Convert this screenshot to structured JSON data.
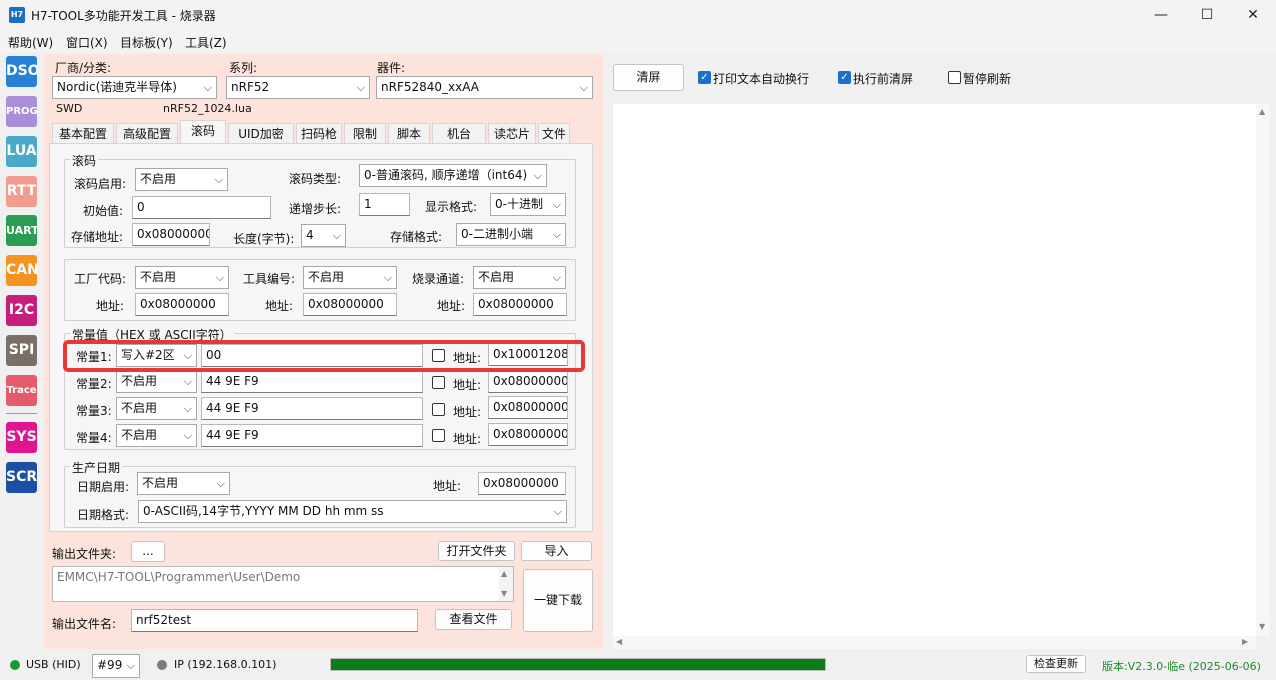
{
  "window": {
    "app_icon": "H7",
    "title": "H7-TOOL多功能开发工具 - 烧录器",
    "minimize": "—",
    "maximize": "☐",
    "close": "✕"
  },
  "menu": [
    "帮助(W)",
    "窗口(X)",
    "目标板(Y)",
    "工具(Z)"
  ],
  "sidebar": [
    {
      "label": "DSO",
      "color": "#2a7fd6"
    },
    {
      "label": "PROG",
      "color": "#a98fd8"
    },
    {
      "label": "LUA",
      "color": "#4aa9c7"
    },
    {
      "label": "RTT",
      "color": "#f29b8f"
    },
    {
      "label": "UART",
      "color": "#2a9d52"
    },
    {
      "label": "CAN",
      "color": "#f59321"
    },
    {
      "label": "I2C",
      "color": "#c51f7e"
    },
    {
      "label": "SPI",
      "color": "#7a6e69"
    },
    {
      "label": "Trace",
      "color": "#e65b6b"
    },
    {
      "label": "SYS",
      "color": "#e0148c"
    },
    {
      "label": "SCR",
      "color": "#1d4fa5"
    }
  ],
  "device": {
    "vendor_label": "厂商/分类:",
    "vendor_value": "Nordic(诺迪克半导体)",
    "series_label": "系列:",
    "series_value": "nRF52",
    "part_label": "器件:",
    "part_value": "nRF52840_xxAA",
    "interface": "SWD",
    "lua_file": "nRF52_1024.lua"
  },
  "tabs": [
    "基本配置",
    "高级配置",
    "滚码",
    "UID加密",
    "扫码枪",
    "限制",
    "脚本",
    "机台",
    "读芯片",
    "文件"
  ],
  "rolling": {
    "group_title": "滚码",
    "enable_label": "滚码启用:",
    "enable_value": "不启用",
    "type_label": "滚码类型:",
    "type_value": "0-普通滚码, 顺序递增（int64)",
    "init_label": "初始值:",
    "init_value": "0",
    "step_label": "递增步长:",
    "step_value": "1",
    "display_label": "显示格式:",
    "display_value": "0-十进制",
    "addr_label": "存储地址:",
    "addr_value": "0x08000000",
    "len_label": "长度(字节):",
    "len_value": "4",
    "store_label": "存储格式:",
    "store_value": "0-二进制小端"
  },
  "factory": {
    "factory_label": "工厂代码:",
    "factory_value": "不启用",
    "tool_label": "工具编号:",
    "tool_value": "不启用",
    "channel_label": "烧录通道:",
    "channel_value": "不启用",
    "addr_label": "地址:",
    "addr1": "0x08000000",
    "addr2": "0x08000000",
    "addr3": "0x08000000"
  },
  "constants": {
    "group_title": "常量值（HEX 或 ASCII字符）",
    "addr_label": "地址:",
    "rows": [
      {
        "label": "常量1:",
        "mode": "写入#2区",
        "value": "00",
        "addr": "0x10001208"
      },
      {
        "label": "常量2:",
        "mode": "不启用",
        "value": "44 9E F9",
        "addr": "0x08000000"
      },
      {
        "label": "常量3:",
        "mode": "不启用",
        "value": "44 9E F9",
        "addr": "0x08000000"
      },
      {
        "label": "常量4:",
        "mode": "不启用",
        "value": "44 9E F9",
        "addr": "0x08000000"
      }
    ]
  },
  "date": {
    "group_title": "生产日期",
    "enable_label": "日期启用:",
    "enable_value": "不启用",
    "addr_label": "地址:",
    "addr_value": "0x08000000",
    "format_label": "日期格式:",
    "format_value": "0-ASCII码,14字节,YYYY MM DD hh mm ss"
  },
  "output": {
    "folder_label": "输出文件夹:",
    "browse": "...",
    "open_folder": "打开文件夹",
    "import": "导入",
    "path": "EMMC\\H7-TOOL\\Programmer\\User\\Demo",
    "one_key": "一键下载",
    "filename_label": "输出文件名:",
    "filename_value": "nrf52test",
    "view_file": "查看文件"
  },
  "right_toolbar": {
    "clear": "清屏",
    "wrap": "打印文本自动换行",
    "clear_before": "执行前清屏",
    "pause": "暂停刷新"
  },
  "status": {
    "usb": "USB (HID)",
    "device_no": "#99",
    "ip": "IP (192.168.0.101)",
    "progress_fraction": 1.0,
    "check_update": "检查更新",
    "version": "版本:V2.3.0-临e (2025-06-06)"
  }
}
